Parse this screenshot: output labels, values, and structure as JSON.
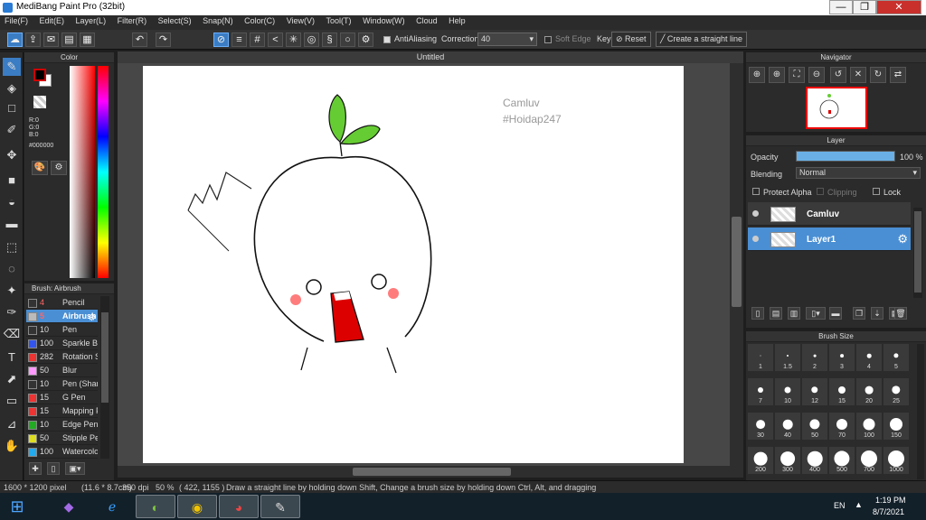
{
  "window": {
    "title": "MediBang Paint Pro (32bit)",
    "controls": [
      "—",
      "❐",
      "✕"
    ]
  },
  "menu": [
    "File(F)",
    "Edit(E)",
    "Layer(L)",
    "Filter(R)",
    "Select(S)",
    "Snap(N)",
    "Color(C)",
    "View(V)",
    "Tool(T)",
    "Window(W)",
    "Cloud",
    "Help"
  ],
  "tool_options": {
    "antialiasing": "AntiAliasing",
    "correction_label": "Correction",
    "correction_value": "40",
    "soft_edge": "Soft Edge",
    "key_label": "Key",
    "reset_button": "Reset",
    "straight_line_button": "Create a straight line"
  },
  "color_panel": {
    "title": "Color",
    "r": "R:0",
    "g": "G:0",
    "b": "B:0",
    "hex": "#000000",
    "foreground": "#000000",
    "background": "#ffffff",
    "accent_red": "#d00000"
  },
  "brush_panel": {
    "title": "Brush: Airbrush",
    "brushes": [
      {
        "size": "4",
        "name": "Pencil",
        "color": "#333333"
      },
      {
        "size": "5",
        "name": "Airbrush",
        "color": "#bbbbbb"
      },
      {
        "size": "10",
        "name": "Pen",
        "color": "#333333"
      },
      {
        "size": "100",
        "name": "Sparkle Br",
        "color": "#3355ee"
      },
      {
        "size": "282",
        "name": "Rotation S",
        "color": "#ee3333"
      },
      {
        "size": "50",
        "name": "Blur",
        "color": "#ff99ff"
      },
      {
        "size": "10",
        "name": "Pen (Shar",
        "color": "#333333"
      },
      {
        "size": "15",
        "name": "G Pen",
        "color": "#ee3333"
      },
      {
        "size": "15",
        "name": "Mapping P",
        "color": "#ee3333"
      },
      {
        "size": "10",
        "name": "Edge Pen",
        "color": "#22aa22"
      },
      {
        "size": "50",
        "name": "Stipple Pe",
        "color": "#dddd22"
      },
      {
        "size": "100",
        "name": "Watercolo",
        "color": "#22aaee"
      }
    ]
  },
  "document": {
    "tab_title": "Untitled",
    "watermark_line1": "Camluv",
    "watermark_line2": "#Hoidap247"
  },
  "navigator": {
    "title": "Navigator"
  },
  "layer_panel": {
    "title": "Layer",
    "opacity_label": "Opacity",
    "opacity_value": "100 %",
    "opacity_fraction": 1.0,
    "blending_label": "Blending",
    "blending_value": "Normal",
    "protect_alpha": "Protect Alpha",
    "clipping": "Clipping",
    "lock": "Lock",
    "layers": [
      {
        "name": "Camluv"
      },
      {
        "name": "Layer1"
      }
    ]
  },
  "brush_size": {
    "title": "Brush Size",
    "sizes": [
      "1",
      "1.5",
      "2",
      "3",
      "4",
      "5",
      "7",
      "10",
      "12",
      "15",
      "20",
      "25",
      "30",
      "40",
      "50",
      "70",
      "100",
      "150",
      "200",
      "300",
      "400",
      "500",
      "700",
      "1000"
    ]
  },
  "status": {
    "dimensions": "1600 * 1200 pixel",
    "physical": "(11.6 * 8.7cm)",
    "dpi": "350 dpi",
    "zoom": "50 %",
    "coords": "( 422, 1155 )",
    "hint": "Draw a straight line by holding down Shift, Change a brush size by holding down Ctrl, Alt, and dragging"
  },
  "taskbar": {
    "language": "EN",
    "time": "1:19 PM",
    "date": "8/7/2021"
  }
}
